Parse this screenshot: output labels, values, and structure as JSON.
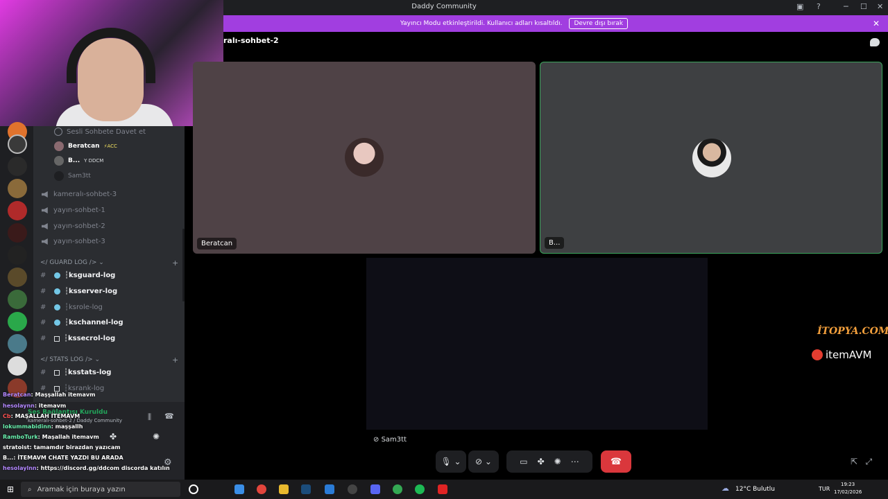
{
  "window": {
    "title": "Daddy Community"
  },
  "banner": {
    "text": "Yayıncı Modu etkinleştirildi. Kullanıcı adları kısaltıldı.",
    "button": "Devre dışı bırak"
  },
  "channel": {
    "name": "ralı-sohbet-2"
  },
  "sidebar": {
    "invite": "Sesli Sohbete Davet et",
    "users": [
      {
        "name": "Beratcan",
        "tag": "⚡ACC"
      },
      {
        "name": "B...",
        "tag": "Y DDCM"
      },
      {
        "name": "Sam3tt",
        "tag": ""
      }
    ],
    "voice_channels": [
      "kameralı-sohbet-3",
      "yayın-sohbet-1",
      "yayın-sohbet-2",
      "yayın-sohbet-3"
    ],
    "guard_category": "</ GUARD LOG /> ⌄",
    "guard_channels": [
      "┆ksguard-log",
      "┆ksserver-log",
      "┆ksrole-log",
      "┆kschannel-log",
      "┆kssecrol-log"
    ],
    "stats_category": "</ STATS LOG /> ⌄",
    "stats_channels": [
      "┆ksstats-log",
      "┆ksrank-log"
    ]
  },
  "voice_panel": {
    "status": "Ses Bağlantısı Kuruldu",
    "location": "kameralı-sohbet-2 / Daddy Community"
  },
  "tiles": [
    {
      "label": "Beratcan",
      "color": "#4f4246"
    },
    {
      "label": "B...",
      "color": "#3e4042"
    },
    {
      "label": "Sam3tt",
      "color": "#0e0e16"
    }
  ],
  "overlay_chat": [
    {
      "user": "Beratcan",
      "msg": ": Maşşallah itemavm",
      "color": "#b388ff"
    },
    {
      "user": "hesolaynn",
      "msg": ": itemavm",
      "color": "#b388ff"
    },
    {
      "user": "Cb",
      "msg": ": MAŞALLAH İTEMAVM",
      "color": "#ff5252"
    },
    {
      "user": "lokummabidinn",
      "msg": ": maşşallh",
      "color": "#69f0ae"
    },
    {
      "user": "RamboTurk",
      "msg": ": Maşallah itemavm",
      "color": "#69f0ae"
    },
    {
      "user": "stratoist",
      "msg": ": tamamdır birazdan yazıcam",
      "color": "#ffffff"
    },
    {
      "user": "B...",
      "msg": ": İTEMAVM CHATE YAZDI BU ARADA",
      "color": "#ffffff"
    },
    {
      "user": "hesolaylnn",
      "msg": ": https://discord.gg/ddcom discorda katılın",
      "color": "#b388ff"
    }
  ],
  "brand": {
    "logo1": "İTOPYA.COM",
    "logo2": "itemAVM"
  },
  "taskbar": {
    "search_placeholder": "Aramak için buraya yazın",
    "weather": "12°C  Bulutlu",
    "lang": "TUR",
    "time": "19:23",
    "date": "17/02/2026"
  },
  "colors": {
    "accent": "#a13ee0",
    "hangup": "#da373c",
    "speaking": "#3ba55c"
  }
}
